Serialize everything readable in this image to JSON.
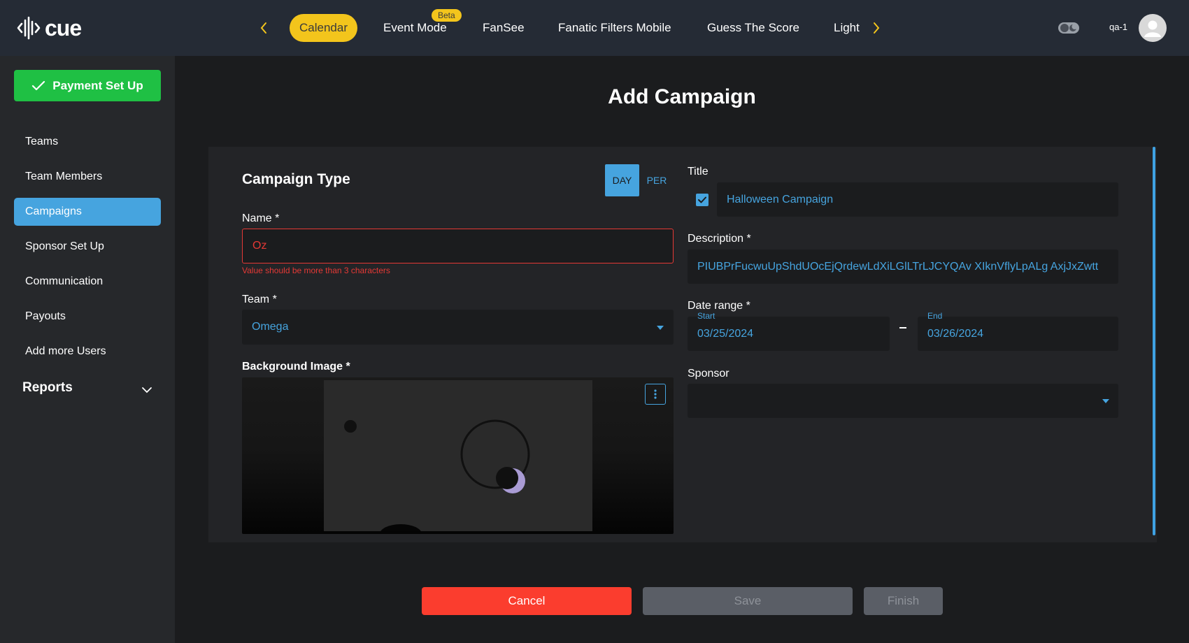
{
  "app": {
    "logo_text": "cue"
  },
  "topnav": {
    "tabs": [
      {
        "label": "Calendar"
      },
      {
        "label": "Event Mode"
      },
      {
        "label": "FanSee"
      },
      {
        "label": "Fanatic Filters Mobile"
      },
      {
        "label": "Guess The Score"
      },
      {
        "label": "Light"
      }
    ],
    "beta_badge": "Beta",
    "user_name": "qa-1"
  },
  "sidebar": {
    "payment_button": "Payment Set Up",
    "items": [
      {
        "label": "Teams"
      },
      {
        "label": "Team Members"
      },
      {
        "label": "Campaigns"
      },
      {
        "label": "Sponsor Set Up"
      },
      {
        "label": "Communication"
      },
      {
        "label": "Payouts"
      },
      {
        "label": "Add more Users"
      }
    ],
    "reports_label": "Reports"
  },
  "page": {
    "title": "Add Campaign"
  },
  "form": {
    "campaign_type_title": "Campaign Type",
    "type_toggle": {
      "day": "DAY",
      "per": "PER"
    },
    "name": {
      "label": "Name *",
      "value": "Oz",
      "error": "Value should be more than 3 characters"
    },
    "team": {
      "label": "Team *",
      "value": "Omega"
    },
    "background_image": {
      "label": "Background Image *"
    },
    "title": {
      "label": "Title",
      "value": "Halloween Campaign",
      "checked": true
    },
    "description": {
      "label": "Description *",
      "value": "PIUBPrFucwuUpShdUOcEjQrdewLdXiLGlLTrLJCYQAv XIknVflyLpALg AxjJxZwtt"
    },
    "date_range": {
      "label": "Date range *",
      "start_label": "Start",
      "start": "03/25/2024",
      "end_label": "End",
      "end": "03/26/2024"
    },
    "sponsor": {
      "label": "Sponsor",
      "value": ""
    }
  },
  "actions": {
    "cancel": "Cancel",
    "save": "Save",
    "finish": "Finish"
  },
  "colors": {
    "accent": "#46a4df",
    "nav_active": "#f3c51c",
    "success": "#1fc044",
    "danger": "#fb3d2e",
    "disabled": "#5a5e66",
    "error": "#e53935"
  }
}
